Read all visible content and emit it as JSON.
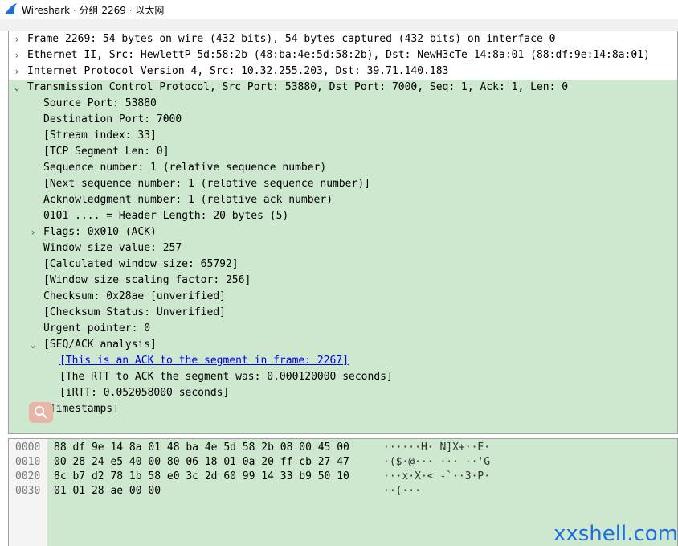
{
  "window": {
    "title": "Wireshark · 分组 2269 · 以太网"
  },
  "tree": {
    "rows": [
      {
        "id": "frame",
        "text": "Frame 2269: 54 bytes on wire (432 bits), 54 bytes captured (432 bits) on interface 0",
        "expanded": false
      },
      {
        "id": "ethernet",
        "text": "Ethernet II, Src: HewlettP_5d:58:2b (48:ba:4e:5d:58:2b), Dst: NewH3cTe_14:8a:01 (88:df:9e:14:8a:01)",
        "expanded": false
      },
      {
        "id": "ip",
        "text": "Internet Protocol Version 4, Src: 10.32.255.203, Dst: 39.71.140.183",
        "expanded": false
      },
      {
        "id": "tcp",
        "text": "Transmission Control Protocol, Src Port: 53880, Dst Port: 7000, Seq: 1, Ack: 1, Len: 0",
        "expanded": true
      }
    ],
    "tcp_fields": [
      "Source Port: 53880",
      "Destination Port: 7000",
      "[Stream index: 33]",
      "[TCP Segment Len: 0]",
      "Sequence number: 1    (relative sequence number)",
      "[Next sequence number: 1    (relative sequence number)]",
      "Acknowledgment number: 1    (relative ack number)",
      "0101 .... = Header Length: 20 bytes (5)",
      "Flags: 0x010 (ACK)",
      "Window size value: 257",
      "[Calculated window size: 65792]",
      "[Window size scaling factor: 256]",
      "Checksum: 0x28ae [unverified]",
      "[Checksum Status: Unverified]",
      "Urgent pointer: 0",
      "[SEQ/ACK analysis]",
      "[Timestamps]"
    ],
    "seq_ack": [
      "[This is an ACK to the segment in frame: 2267]",
      "[The RTT to ACK the segment was: 0.000120000 seconds]",
      "[iRTT: 0.052058000 seconds]"
    ]
  },
  "hex": {
    "lines": [
      {
        "offset": "0000",
        "bytes": "88 df 9e 14 8a 01 48 ba  4e 5d 58 2b 08 00 45 00",
        "ascii": "······H· N]X+··E·"
      },
      {
        "offset": "0010",
        "bytes": "00 28 24 e5 40 00 80 06  18 01 0a 20 ff cb 27 47",
        "ascii": "·($·@··· ··· ··'G"
      },
      {
        "offset": "0020",
        "bytes": "8c b7 d2 78 1b 58 e0 3c  2d 60 99 14 33 b9 50 10",
        "ascii": "···x·X·< -`··3·P·"
      },
      {
        "offset": "0030",
        "bytes": "01 01 28 ae 00 00",
        "ascii": "··(···"
      }
    ]
  },
  "watermark": "xxshell.com",
  "colors": {
    "selected_bg": "#cde8cf",
    "link": "#0000ee",
    "watermark": "#1d6fe0",
    "fin": "#1f6fd1"
  }
}
